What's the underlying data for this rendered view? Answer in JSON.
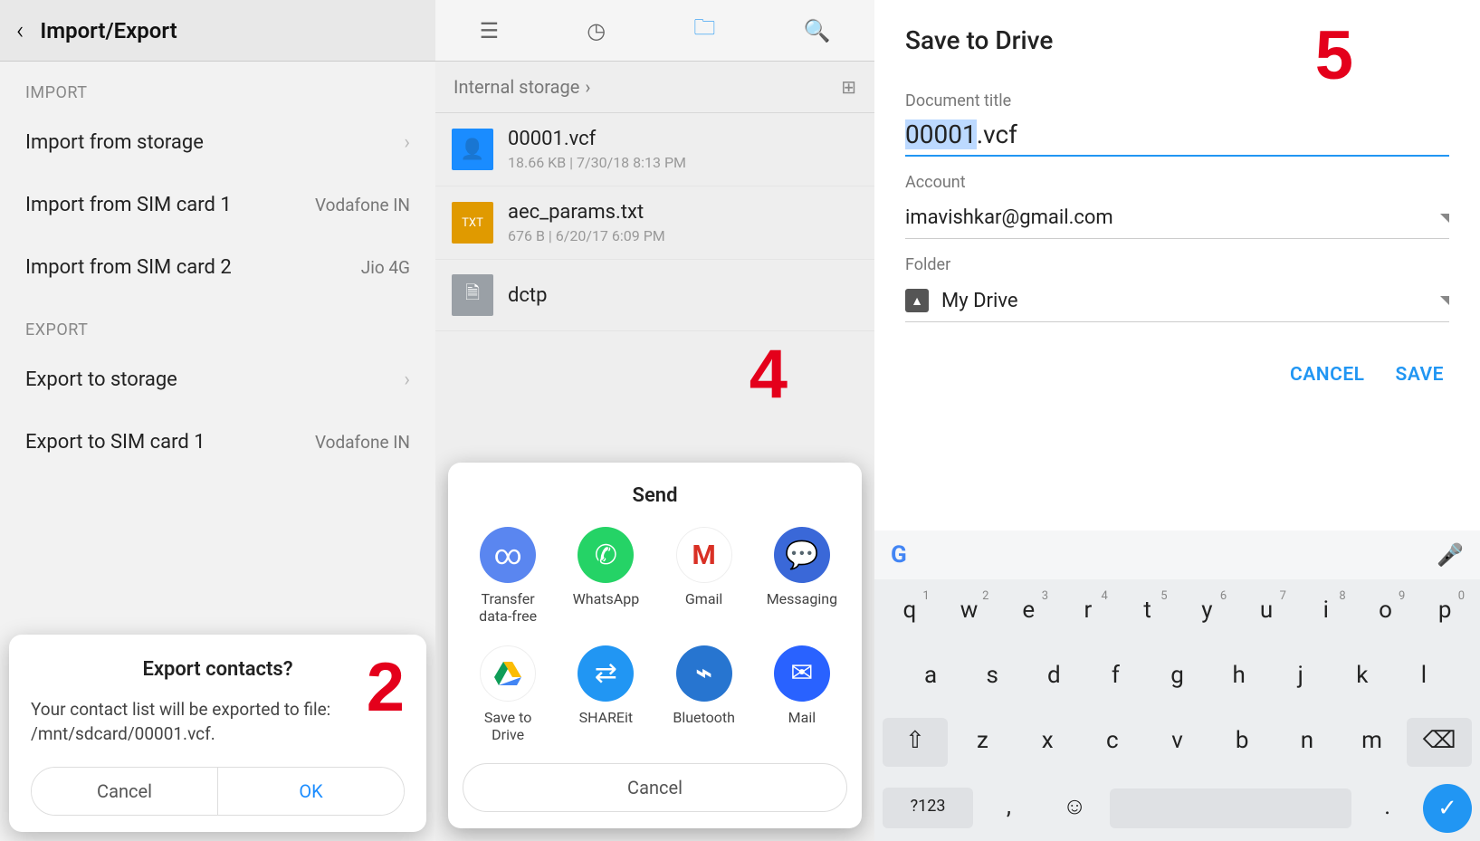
{
  "panel1": {
    "title": "Import/Export",
    "section_import": "IMPORT",
    "import_storage": "Import from storage",
    "import_sim1": "Import from SIM card 1",
    "import_sim1_sub": "Vodafone IN",
    "import_sim2": "Import from SIM card 2",
    "import_sim2_sub": "Jio 4G",
    "section_export": "EXPORT",
    "export_storage": "Export to storage",
    "export_sim1": "Export to SIM card 1",
    "export_sim1_sub": "Vodafone IN",
    "dialog": {
      "title": "Export contacts?",
      "body": "Your contact list will be exported to file: /mnt/sdcard/00001.vcf.",
      "cancel": "Cancel",
      "ok": "OK"
    },
    "step": "2"
  },
  "panel2": {
    "breadcrumb": "Internal storage",
    "files": [
      {
        "name": "00001.vcf",
        "meta": "18.66 KB  |  7/30/18 8:13 PM"
      },
      {
        "name": "aec_params.txt",
        "meta": "676 B  |  6/20/17 6:09 PM"
      },
      {
        "name": "dctp",
        "meta": ""
      }
    ],
    "sheet": {
      "title": "Send",
      "apps": [
        "Transfer data-free",
        "WhatsApp",
        "Gmail",
        "Messaging",
        "Save to Drive",
        "SHAREit",
        "Bluetooth",
        "Mail"
      ],
      "cancel": "Cancel"
    },
    "step": "4"
  },
  "panel3": {
    "title": "Save to Drive",
    "doc_label": "Document title",
    "doc_value_sel": "00001",
    "doc_value_rest": ".vcf",
    "acct_label": "Account",
    "acct_value": "imavishkar@gmail.com",
    "folder_label": "Folder",
    "folder_value": "My Drive",
    "cancel": "CANCEL",
    "save": "SAVE",
    "step": "5",
    "keyboard": {
      "row1": [
        "q",
        "w",
        "e",
        "r",
        "t",
        "y",
        "u",
        "i",
        "o",
        "p"
      ],
      "row1_sup": [
        "1",
        "2",
        "3",
        "4",
        "5",
        "6",
        "7",
        "8",
        "9",
        "0"
      ],
      "row2": [
        "a",
        "s",
        "d",
        "f",
        "g",
        "h",
        "j",
        "k",
        "l"
      ],
      "row3": [
        "z",
        "x",
        "c",
        "v",
        "b",
        "n",
        "m"
      ],
      "symKey": "?123",
      "comma": ",",
      "period": "."
    }
  }
}
